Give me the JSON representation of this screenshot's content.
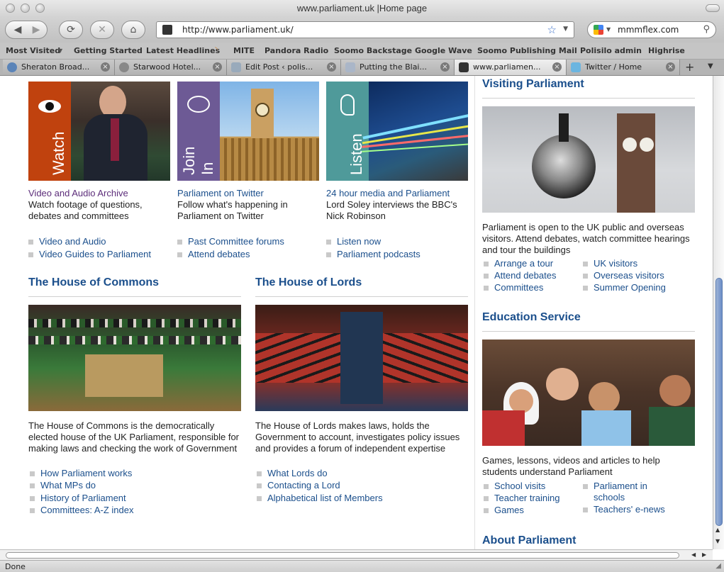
{
  "window": {
    "title": "www.parliament.uk |Home page"
  },
  "navigation": {
    "url": "http://www.parliament.uk/",
    "search_value": "mmmflex.com"
  },
  "bookmarks": [
    "Most Visited",
    "Getting Started",
    "Latest Headlines",
    "MITE",
    "Pandora Radio",
    "Soomo Backstage",
    "Google Wave",
    "Soomo Publishing Mail",
    "Polisilo admin",
    "Highrise"
  ],
  "tabs": [
    {
      "label": "Sheraton Broad..."
    },
    {
      "label": "Starwood Hotel..."
    },
    {
      "label": "Edit Post ‹ polis..."
    },
    {
      "label": "Putting the Blai..."
    },
    {
      "label": "www.parliamen..."
    },
    {
      "label": "Twitter / Home"
    }
  ],
  "features": [
    {
      "panel_label": "Watch",
      "panel_color": "#c0420e",
      "title": "Video and Audio Archive",
      "desc": "Watch footage of questions, debates and committees",
      "links": [
        "Video and Audio",
        "Video Guides to Parliament"
      ]
    },
    {
      "panel_label": "Join In",
      "panel_color": "#6d5a95",
      "title": "Parliament on Twitter",
      "desc": "Follow what's happening in Parliament on Twitter",
      "links": [
        "Past Committee forums",
        "Attend debates"
      ]
    },
    {
      "panel_label": "Listen",
      "panel_color": "#4f9a9a",
      "title": "24 hour media and Parliament",
      "desc": "Lord Soley interviews the BBC's Nick Robinson",
      "links": [
        "Listen now",
        "Parliament podcasts"
      ]
    }
  ],
  "commons": {
    "heading": "The House of Commons",
    "desc": "The House of Commons is the democratically elected house of the UK Parliament, responsible for making laws and checking the work of Government",
    "links": [
      "How Parliament works",
      "What MPs do",
      "History of Parliament",
      "Committees: A-Z index"
    ]
  },
  "lords": {
    "heading": "The House of Lords",
    "desc": "The House of Lords makes laws, holds the Government to account, investigates policy issues and provides a forum of independent expertise",
    "links": [
      "What Lords do",
      "Contacting a Lord",
      "Alphabetical list of Members"
    ]
  },
  "visiting": {
    "heading": "Visiting Parliament",
    "desc": "Parliament is open to the UK public and overseas visitors. Attend debates, watch committee hearings and tour the buildings",
    "links_left": [
      "Arrange a tour",
      "Attend debates",
      "Committees"
    ],
    "links_right": [
      "UK visitors",
      "Overseas visitors",
      "Summer Opening"
    ]
  },
  "education": {
    "heading": "Education Service",
    "desc": "Games, lessons, videos and articles to help students understand Parliament",
    "links_left": [
      "School visits",
      "Teacher training",
      "Games"
    ],
    "links_right": [
      "Parliament in schools",
      "Teachers' e-news"
    ]
  },
  "about": {
    "heading": "About Parliament"
  },
  "status": {
    "text": "Done"
  }
}
